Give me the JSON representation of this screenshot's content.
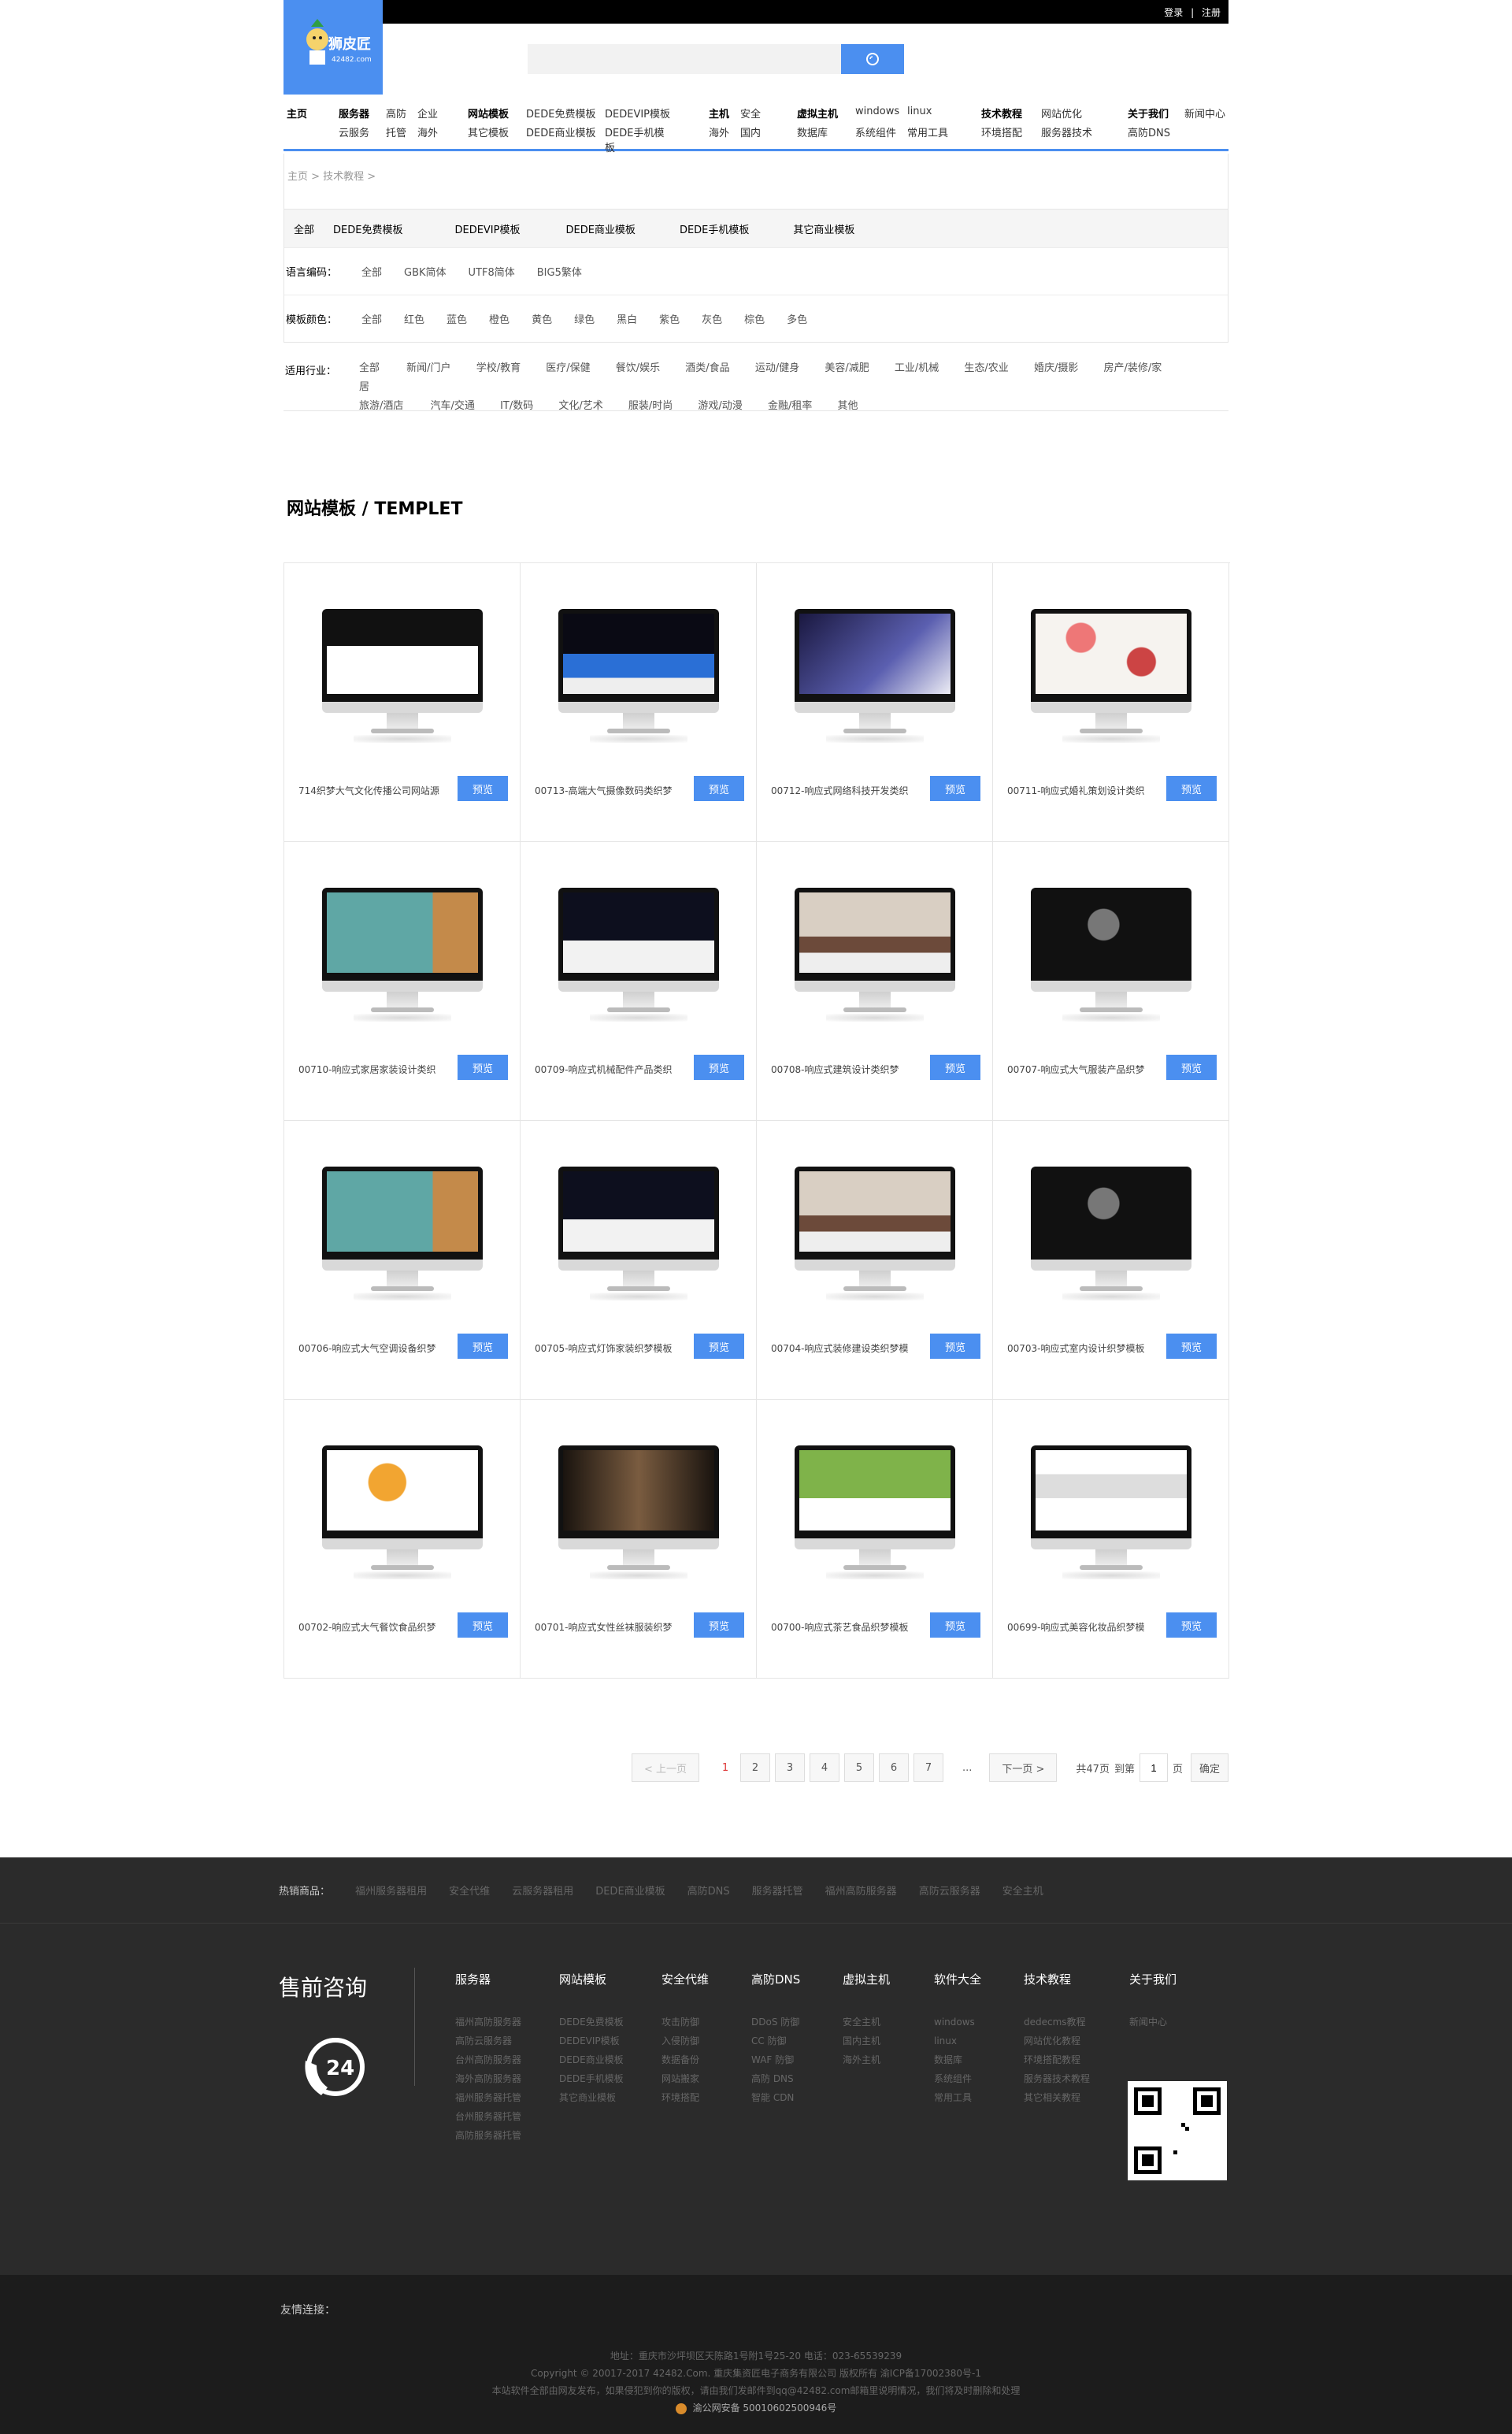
{
  "topbar": {
    "login": "登录",
    "sep": "|",
    "register": "注册"
  },
  "logo": {
    "text": "狮皮匠",
    "sub": "42482.com"
  },
  "search": {
    "placeholder": "",
    "value": ""
  },
  "nav": {
    "home": "主页",
    "groups": [
      {
        "head": "服务器",
        "items": [
          "高防",
          "企业",
          "云服务",
          "托管",
          "海外"
        ]
      },
      {
        "head": "网站模板",
        "items": [
          "DEDE免费模板",
          "DEDEVIP模板",
          "其它模板",
          "DEDE商业模板",
          "DEDE手机模板"
        ]
      },
      {
        "head": "主机",
        "items": [
          "安全",
          "海外",
          "国内"
        ]
      },
      {
        "head": "虚拟主机",
        "items": [
          "windows",
          "linux",
          "数据库",
          "系统组件",
          "常用工具"
        ]
      },
      {
        "head": "技术教程",
        "items": [
          "网站优化",
          "环境搭配",
          "服务器技术"
        ]
      },
      {
        "head": "关于我们",
        "items": [
          "新闻中心",
          "高防DNS"
        ]
      }
    ]
  },
  "breadcrumb": "主页 > 技术教程 >",
  "filters": {
    "tabs": [
      "全部",
      "DEDE免费模板",
      "DEDEVIP模板",
      "DEDE商业模板",
      "DEDE手机模板",
      "其它商业模板"
    ],
    "encoding": {
      "label": "语言编码：",
      "options": [
        "全部",
        "GBK简体",
        "UTF8简体",
        "BIG5繁体"
      ]
    },
    "color": {
      "label": "模板颜色：",
      "options": [
        "全部",
        "红色",
        "蓝色",
        "橙色",
        "黄色",
        "绿色",
        "黑白",
        "紫色",
        "灰色",
        "棕色",
        "多色"
      ]
    },
    "industry": {
      "label": "适用行业：",
      "options": [
        "全部",
        "新闻/门户",
        "学校/教育",
        "医疗/保健",
        "餐饮/娱乐",
        "酒类/食品",
        "运动/健身",
        "美容/减肥",
        "工业/机械",
        "生态/农业",
        "婚庆/摄影",
        "房产/装修/家居",
        "旅游/酒店",
        "汽车/交通",
        "IT/数码",
        "文化/艺术",
        "服装/时尚",
        "游戏/动漫",
        "金融/租率",
        "其他"
      ]
    }
  },
  "section_title": "网站模板 / TEMPLET",
  "preview_label": "预览",
  "templates": [
    {
      "title": "714织梦大气文化传播公司网站源",
      "screen": "dark"
    },
    {
      "title": "00713-高端大气摄像数码类织梦",
      "screen": "blue"
    },
    {
      "title": "00712-响应式网络科技开发类织",
      "screen": "purple"
    },
    {
      "title": "00711-响应式婚礼策划设计类织",
      "screen": "flowers"
    },
    {
      "title": "00710-响应式家居家装设计类织",
      "screen": "teal"
    },
    {
      "title": "00709-响应式机械配件产品类织",
      "screen": "darkcar"
    },
    {
      "title": "00708-响应式建筑设计类织梦",
      "screen": "interior"
    },
    {
      "title": "00707-响应式大气服装产品织梦",
      "screen": "portrait"
    },
    {
      "title": "00706-响应式大气空调设备织梦",
      "screen": "teal"
    },
    {
      "title": "00705-响应式灯饰家装织梦模板",
      "screen": "darkcar"
    },
    {
      "title": "00704-响应式装修建设类织梦模",
      "screen": "interior"
    },
    {
      "title": "00703-响应式室内设计织梦模板",
      "screen": "portrait"
    },
    {
      "title": "00702-响应式大气餐饮食品织梦",
      "screen": "food"
    },
    {
      "title": "00701-响应式女性丝袜服装织梦",
      "screen": "fashion"
    },
    {
      "title": "00700-响应式茶艺食品织梦模板",
      "screen": "tea"
    },
    {
      "title": "00699-响应式美容化妆品织梦模",
      "screen": "cosmetic"
    }
  ],
  "pagination": {
    "prev": "< 上一页",
    "current": "1",
    "pages": [
      "2",
      "3",
      "4",
      "5",
      "6",
      "7"
    ],
    "ellipsis": "...",
    "next": "下一页 >",
    "total": "共47页",
    "goto": "到第",
    "page_value": "1",
    "page_unit": "页",
    "confirm": "确定"
  },
  "footer": {
    "hot_label": "热销商品：",
    "hot_items": [
      "福州服务器租用",
      "安全代维",
      "云服务器租用",
      "DEDE商业模板",
      "高防DNS",
      "服务器托管",
      "福州高防服务器",
      "高防云服务器",
      "安全主机"
    ],
    "consult": "售前咨询",
    "columns": [
      {
        "head": "服务器",
        "items": [
          "福州高防服务器",
          "高防云服务器",
          "台州高防服务器",
          "海外高防服务器",
          "福州服务器托管",
          "台州服务器托管",
          "高防服务器托管"
        ]
      },
      {
        "head": "网站模板",
        "items": [
          "DEDE免费模板",
          "DEDEVIP模板",
          "DEDE商业模板",
          "DEDE手机模板",
          "其它商业模板"
        ]
      },
      {
        "head": "安全代维",
        "items": [
          "攻击防御",
          "入侵防御",
          "数据备份",
          "网站搬家",
          "环境搭配"
        ]
      },
      {
        "head": "高防DNS",
        "items": [
          "DDoS 防御",
          "CC 防御",
          "WAF 防御",
          "高防 DNS",
          "智能 CDN"
        ]
      },
      {
        "head": "虚拟主机",
        "items": [
          "安全主机",
          "国内主机",
          "海外主机"
        ]
      },
      {
        "head": "软件大全",
        "items": [
          "windows",
          "linux",
          "数据库",
          "系统组件",
          "常用工具"
        ]
      },
      {
        "head": "技术教程",
        "items": [
          "dedecms教程",
          "网站优化教程",
          "环境搭配教程",
          "服务器技术教程",
          "其它相关教程"
        ]
      },
      {
        "head": "关于我们",
        "items": [
          "新闻中心"
        ]
      }
    ],
    "friend_links": "友情连接：",
    "address": "地址：重庆市沙坪坝区天陈路1号附1号25-20  电话：023-65539239",
    "copyright": "Copyright © 20017-2017 42482.Com. 重庆集资匠电子商务有限公司 版权所有  渝ICP备17002380号-1",
    "notice": "本站软件全部由网友发布，如果侵犯到你的版权，请由我们发邮件到qq@42482.com邮箱里说明情况，我们将及时删除和处理",
    "police": "渝公网安备 50010602500946号"
  }
}
